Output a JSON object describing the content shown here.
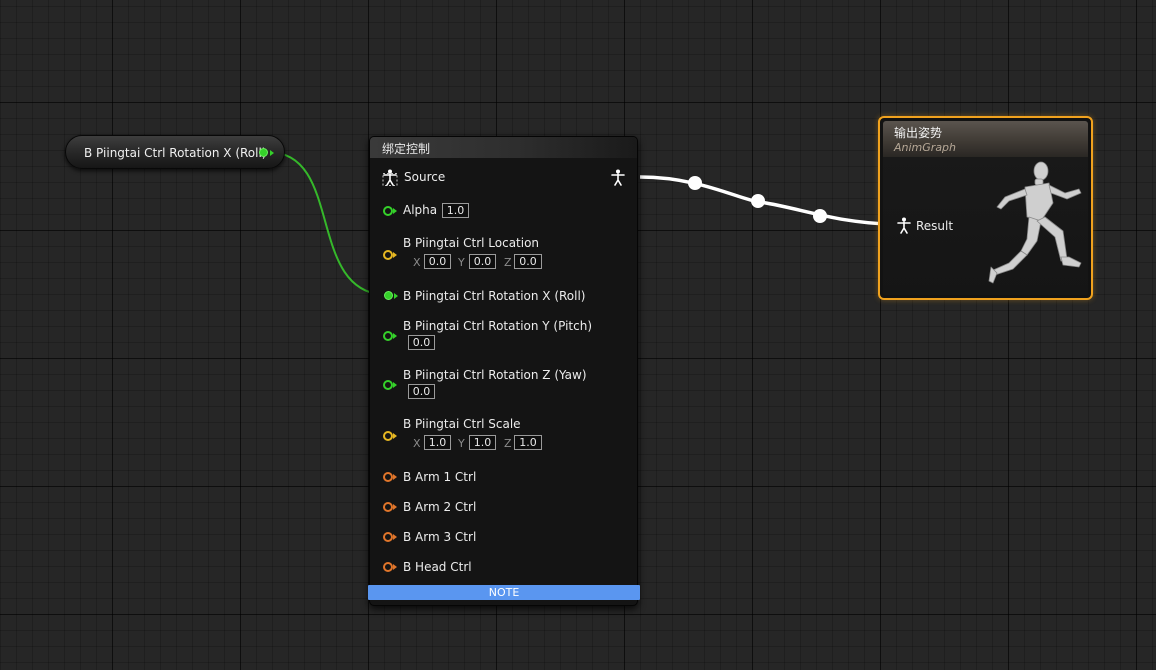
{
  "graph": {
    "background": "#262626"
  },
  "variable_node": {
    "label": "B Piingtai Ctrl Rotation X (Roll)",
    "pin_color": "#35d12a"
  },
  "control_rig_node": {
    "title": "绑定控制",
    "source_label": "Source",
    "alpha": {
      "label": "Alpha",
      "value": "1.0"
    },
    "location": {
      "label": "B Piingtai Ctrl Location",
      "x_label": "X",
      "x": "0.0",
      "y_label": "Y",
      "y": "0.0",
      "z_label": "Z",
      "z": "0.0"
    },
    "rotation_x": {
      "label": "B Piingtai Ctrl Rotation X (Roll)"
    },
    "rotation_y": {
      "label": "B Piingtai Ctrl Rotation Y (Pitch)",
      "value": "0.0"
    },
    "rotation_z": {
      "label": "B Piingtai Ctrl Rotation Z (Yaw)",
      "value": "0.0"
    },
    "scale": {
      "label": "B Piingtai Ctrl Scale",
      "x_label": "X",
      "x": "1.0",
      "y_label": "Y",
      "y": "1.0",
      "z_label": "Z",
      "z": "1.0"
    },
    "arm1": "B Arm 1 Ctrl",
    "arm2": "B Arm 2 Ctrl",
    "arm3": "B Arm 3 Ctrl",
    "head": "B Head Ctrl",
    "note_label": "NOTE",
    "note_color": "#5a96f0"
  },
  "output_node": {
    "title": "输出姿势",
    "subtitle": "AnimGraph",
    "result_label": "Result",
    "border_color": "#f0a21e"
  },
  "icons": {
    "source_pin": "pose-person-icon",
    "source_out": "pose-person-icon",
    "result_pin": "pose-person-icon",
    "mannequin": "running-mannequin-icon"
  }
}
